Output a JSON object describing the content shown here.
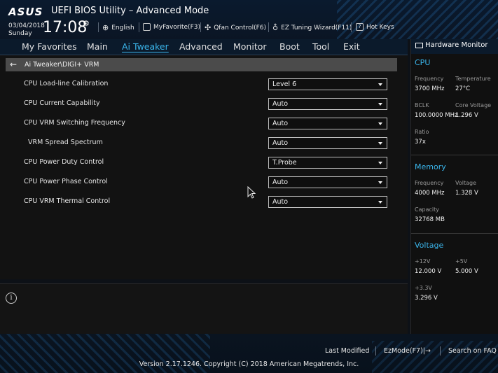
{
  "header": {
    "brand": "ASUS",
    "title": "UEFI BIOS Utility – Advanced Mode",
    "date": "03/04/2018",
    "day": "Sunday",
    "time": "17:08",
    "toolbar": [
      {
        "label": "English",
        "icon": "globe-icon"
      },
      {
        "label": "MyFavorite(F3)",
        "icon": "favorite-icon"
      },
      {
        "label": "Qfan Control(F6)",
        "icon": "fan-icon"
      },
      {
        "label": "EZ Tuning Wizard(F11)",
        "icon": "lightbulb-icon"
      },
      {
        "label": "Hot Keys",
        "icon": "question-icon"
      }
    ]
  },
  "menu": {
    "items": [
      "My Favorites",
      "Main",
      "Ai Tweaker",
      "Advanced",
      "Monitor",
      "Boot",
      "Tool",
      "Exit"
    ],
    "active": "Ai Tweaker"
  },
  "breadcrumb": "Ai Tweaker\\DIGI+ VRM",
  "settings": [
    {
      "label": "CPU Load-line Calibration",
      "value": "Level 6"
    },
    {
      "label": "CPU Current Capability",
      "value": "Auto"
    },
    {
      "label": "CPU VRM Switching Frequency",
      "value": "Auto"
    },
    {
      "label": "VRM Spread Spectrum",
      "value": "Auto"
    },
    {
      "label": "CPU Power Duty Control",
      "value": "T.Probe"
    },
    {
      "label": "CPU Power Phase Control",
      "value": "Auto"
    },
    {
      "label": "CPU VRM Thermal Control",
      "value": "Auto"
    }
  ],
  "hardware_monitor": {
    "title": "Hardware Monitor",
    "cpu": {
      "heading": "CPU",
      "frequency_label": "Frequency",
      "frequency": "3700 MHz",
      "temperature_label": "Temperature",
      "temperature": "27°C",
      "bclk_label": "BCLK",
      "bclk": "100.0000 MHz",
      "core_voltage_label": "Core Voltage",
      "core_voltage": "1.296 V",
      "ratio_label": "Ratio",
      "ratio": "37x"
    },
    "memory": {
      "heading": "Memory",
      "frequency_label": "Frequency",
      "frequency": "4000 MHz",
      "voltage_label": "Voltage",
      "voltage": "1.328 V",
      "capacity_label": "Capacity",
      "capacity": "32768 MB"
    },
    "voltage": {
      "heading": "Voltage",
      "v12_label": "+12V",
      "v12": "12.000 V",
      "v5_label": "+5V",
      "v5": "5.000 V",
      "v33_label": "+3.3V",
      "v33": "3.296 V"
    }
  },
  "footer": {
    "last_modified": "Last Modified",
    "ezmode": "EzMode(F7)|",
    "search_faq": "Search on FAQ",
    "copyright": "Version 2.17.1246. Copyright (C) 2018 American Megatrends, Inc."
  }
}
